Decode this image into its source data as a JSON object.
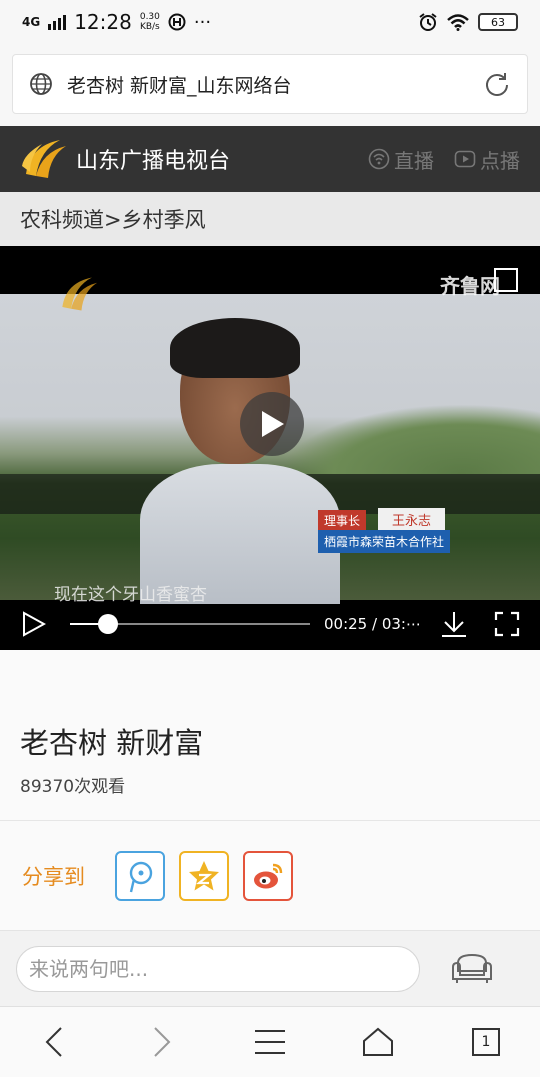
{
  "status_bar": {
    "signal": "4G",
    "time": "12:28",
    "speed_value": "0.30",
    "speed_unit": "KB/s",
    "battery": "63"
  },
  "url_bar": {
    "title": "老杏树 新财富_山东网络台"
  },
  "site_header": {
    "name": "山东广播电视台",
    "live_label": "直播",
    "vod_label": "点播"
  },
  "breadcrumb": {
    "text": "农科频道>乡村季风"
  },
  "video": {
    "watermark": "齐鲁网",
    "role_tag": "理事长",
    "name_tag": "王永志",
    "org_tag": "栖霞市森荣苗木合作社",
    "subtitle": "现在这个牙山香蜜杏",
    "time_display": "00:25 / 03:⋯",
    "progress": 0.16
  },
  "main": {
    "title": "老杏树 新财富",
    "views": "89370次观看"
  },
  "share": {
    "label": "分享到"
  },
  "comment": {
    "placeholder": "来说两句吧..."
  },
  "navbar": {
    "tab_count": "1"
  }
}
